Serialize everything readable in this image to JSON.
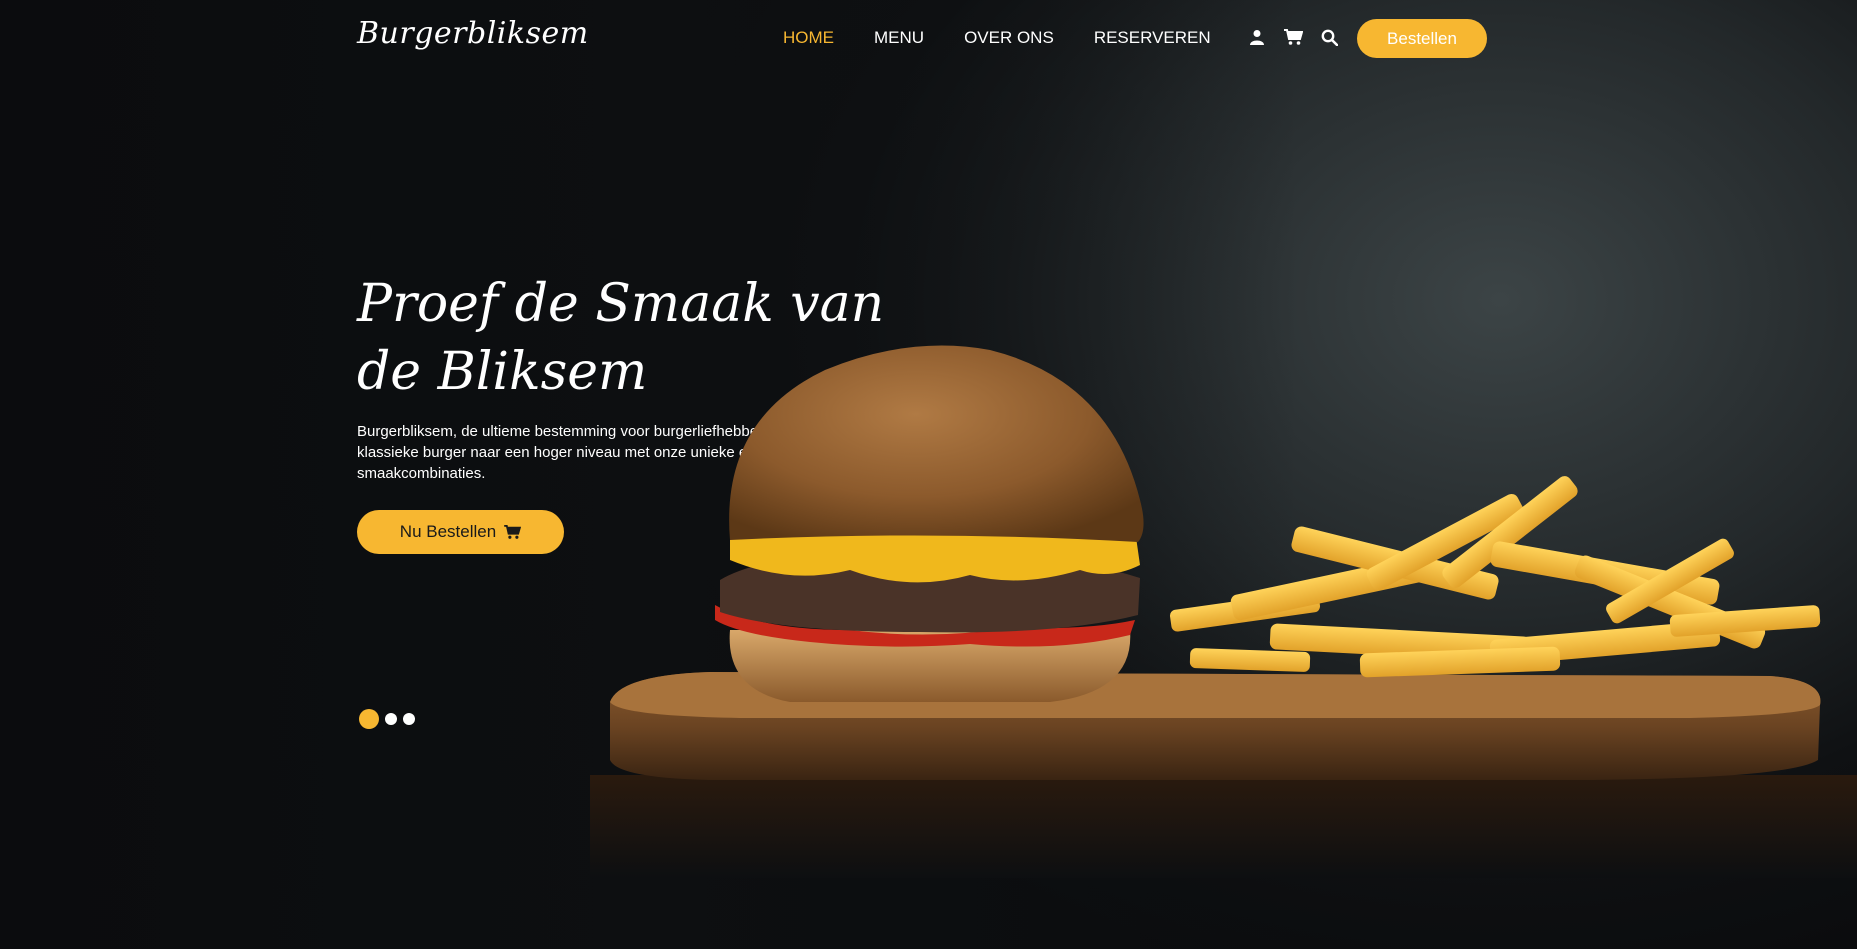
{
  "brand": {
    "name": "Burgerbliksem"
  },
  "nav": [
    {
      "label": "HOME",
      "active": true
    },
    {
      "label": "MENU",
      "active": false
    },
    {
      "label": "OVER ONS",
      "active": false
    },
    {
      "label": "RESERVEREN",
      "active": false
    }
  ],
  "header_icons": [
    "user-icon",
    "cart-icon",
    "search-icon"
  ],
  "header": {
    "order_button": "Bestellen"
  },
  "hero": {
    "title": "Proef de Smaak van de Bliksem",
    "text": "Burgerbliksem, de ultieme bestemming voor burgerliefhebbers. Wij brengen de klassieke burger naar een hoger niveau met onze unieke en verrassende smaakcombinaties.",
    "cta_label": "Nu Bestellen"
  },
  "slider": {
    "count": 3,
    "active_index": 0
  },
  "colors": {
    "accent": "#f7b731",
    "background": "#0d0f11",
    "text": "#ffffff"
  }
}
